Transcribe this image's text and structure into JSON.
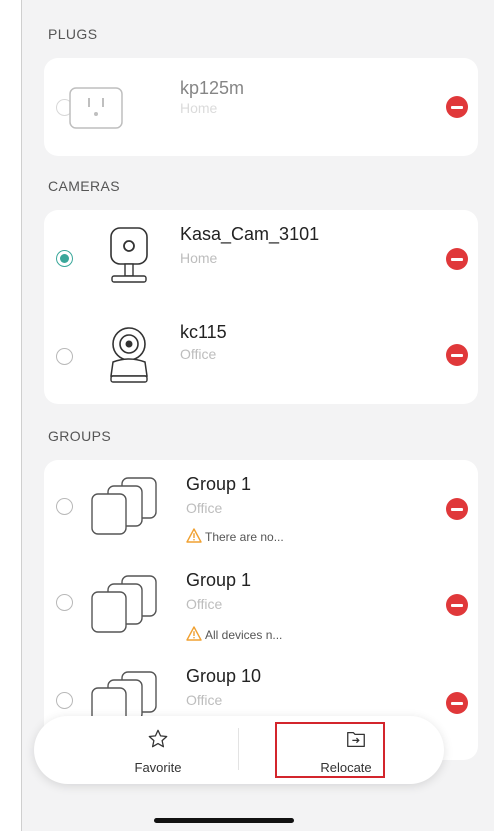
{
  "sections": {
    "plugs_label": "PLUGS",
    "cameras_label": "CAMERAS",
    "groups_label": "GROUPS"
  },
  "plugs": [
    {
      "name": "kp125m",
      "location": "Home",
      "selected": false,
      "icon": "smart-plug-icon"
    }
  ],
  "cameras": [
    {
      "name": "Kasa_Cam_3101",
      "location": "Home",
      "selected": true,
      "icon": "indoor-camera-icon"
    },
    {
      "name": "kc115",
      "location": "Office",
      "selected": false,
      "icon": "pan-tilt-camera-icon"
    }
  ],
  "groups": [
    {
      "name": "Group 1",
      "location": "Office",
      "warning": "There are no...",
      "icon": "group-stack-icon"
    },
    {
      "name": "Group 1",
      "location": "Office",
      "warning": "All devices n...",
      "icon": "group-stack-icon"
    },
    {
      "name": "Group 10",
      "location": "Office",
      "icon": "group-stack-icon"
    }
  ],
  "bottom_bar": {
    "favorite_label": "Favorite",
    "relocate_label": "Relocate"
  },
  "colors": {
    "accent_teal": "#3aa79a",
    "remove_red": "#e0383a",
    "highlight_red": "#d3252c",
    "warning_orange": "#f0a030"
  }
}
